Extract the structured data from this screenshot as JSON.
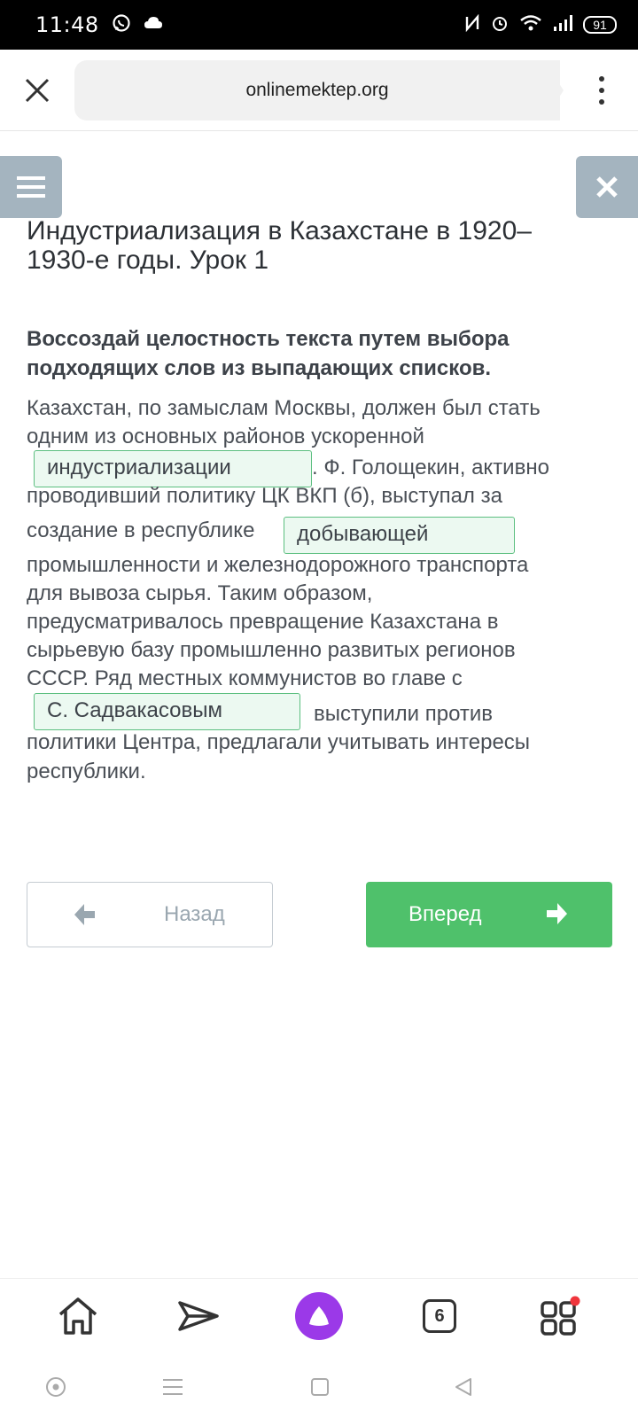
{
  "status_bar": {
    "time": "11:48",
    "battery": "91",
    "icons": [
      "whatsapp-icon",
      "cloud-icon",
      "nfc-icon",
      "alarm-icon",
      "wifi-icon",
      "signal-icon",
      "battery-icon"
    ]
  },
  "browser": {
    "url": "onlinemektep.org",
    "icons": [
      "close-icon",
      "more-vert-icon"
    ]
  },
  "page": {
    "title_line1": "Индустриализация в Казахстане в 1920–",
    "title_line2": "1930-е годы. Урок 1",
    "instruction_line1": "Воссоздай целостность текста путем выбора",
    "instruction_line2": "подходящих слов из выпадающих списков.",
    "passage": {
      "l1": "Казахстан, по замыслам Москвы, должен был стать",
      "l2": "одним из основных районов ускоренной",
      "dd1": "индустриализации",
      "l3_after": ". Ф. Голощекин, активно",
      "l4": "проводивший политику ЦК ВКП (б), выступал за",
      "l5_before": "создание в республике",
      "dd2": "добывающей",
      "l6": " промышленности и железнодорожного транспорта",
      "l7": "для вывоза сырья. Таким образом,",
      "l8": "предусматривалось превращение Казахстана в",
      "l9": "сырьевую базу промышленно развитых регионов",
      "l10": "СССР. Ряд местных коммунистов во главе с",
      "dd3": "С. Садвакасовым",
      "l11_after": "выступили против",
      "l12": "политики Центра, предлагали учитывать интересы",
      "l13": "республики."
    },
    "back_label": "Назад",
    "next_label": "Вперед"
  },
  "app_bar": {
    "tabs_count": "6",
    "icons": [
      "home-icon",
      "send-icon",
      "alice-icon",
      "tabs-icon",
      "services-icon"
    ]
  },
  "colors": {
    "accent_green": "#4fc16b",
    "dropdown_border": "#5cbf80",
    "dropdown_bg": "#ecf9f1",
    "side_button": "#a4b4bf",
    "alice_purple": "#9b39e8"
  }
}
